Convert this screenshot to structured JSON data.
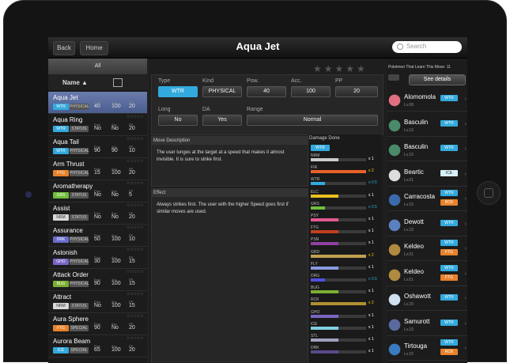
{
  "window": {
    "back": "Back",
    "home": "Home",
    "title": "Aqua Jet",
    "search_placeholder": "Search"
  },
  "colors": {
    "water": "#33aadd",
    "fighting": "#e8822a",
    "grass": "#6fbf3a",
    "normal": "#d8d8d8",
    "status": "#555555",
    "dark": "#6a6acc",
    "ghost": "#7a65c4",
    "bug": "#7ab030",
    "psychic": "#cc4488",
    "ice": "#d8f0f8",
    "physical": "#555555",
    "special": "#555555"
  },
  "list": {
    "all_label": "All",
    "sort_label": "Name ▲",
    "col_pow": "Pow.",
    "col_acc": "Acc.",
    "col_pp": "PP",
    "items": [
      {
        "name": "Aqua Jet",
        "type": "WTR",
        "tc": "#33aadd",
        "kind": "PHYSICAL",
        "pow": "40",
        "acc": "100",
        "pp": "20",
        "sel": true
      },
      {
        "name": "Aqua Ring",
        "type": "WTR",
        "tc": "#33aadd",
        "kind": "STATUS",
        "pow": "No",
        "acc": "No",
        "pp": "20"
      },
      {
        "name": "Aqua Tail",
        "type": "WTR",
        "tc": "#33aadd",
        "kind": "PHYSICAL",
        "pow": "90",
        "acc": "90",
        "pp": "10"
      },
      {
        "name": "Arm Thrust",
        "type": "FTG",
        "tc": "#e8822a",
        "kind": "PHYSICAL",
        "pow": "15",
        "acc": "100",
        "pp": "20"
      },
      {
        "name": "Aromatherapy",
        "type": "GRS",
        "tc": "#6fbf3a",
        "kind": "STATUS",
        "pow": "No",
        "acc": "No",
        "pp": "5"
      },
      {
        "name": "Assist",
        "type": "NRM",
        "tc": "#d8d8d8",
        "kind": "STATUS",
        "pow": "No",
        "acc": "No",
        "pp": "20"
      },
      {
        "name": "Assurance",
        "type": "DRK",
        "tc": "#6a6acc",
        "kind": "PHYSICAL",
        "pow": "50",
        "acc": "100",
        "pp": "10"
      },
      {
        "name": "Astonish",
        "type": "GHO",
        "tc": "#7a65c4",
        "kind": "PHYSICAL",
        "pow": "30",
        "acc": "100",
        "pp": "15"
      },
      {
        "name": "Attack Order",
        "type": "BUG",
        "tc": "#7ab030",
        "kind": "PHYSICAL",
        "pow": "90",
        "acc": "100",
        "pp": "15"
      },
      {
        "name": "Attract",
        "type": "NRM",
        "tc": "#d8d8d8",
        "kind": "STATUS",
        "pow": "No",
        "acc": "100",
        "pp": "15"
      },
      {
        "name": "Aura Sphere",
        "type": "FTG",
        "tc": "#e8822a",
        "kind": "SPECIAL",
        "pow": "90",
        "acc": "No",
        "pp": "20"
      },
      {
        "name": "Aurora Beam",
        "type": "ICE",
        "tc": "#33aadd",
        "kind": "SPECIAL",
        "pow": "65",
        "acc": "100",
        "pp": "20"
      }
    ]
  },
  "detail": {
    "type_label": "Type",
    "type": "WTR",
    "kind_label": "Kind",
    "kind": "PHYSICAL",
    "pow_label": "Pow.",
    "pow": "40",
    "acc_label": "Acc.",
    "acc": "100",
    "pp_label": "PP",
    "pp": "20",
    "long_label": "Long",
    "long": "No",
    "da_label": "DA",
    "da": "Yes",
    "range_label": "Range",
    "range": "Normal",
    "desc_head": "Move Description",
    "desc": "The user lunges at the target at a speed that makes it almost invisible. It is sure to strike first.",
    "effect_head": "Effect",
    "effect": "Always strikes first. The user with the higher Speed goes first if similar moves are used."
  },
  "damage": {
    "head": "Damage Done",
    "type": "WTR",
    "rows": [
      {
        "t": "NRM",
        "c": "#cccccc",
        "v": 0.5,
        "m": "x 1",
        "mc": "#ffffff"
      },
      {
        "t": "FIR",
        "c": "#e8622a",
        "v": 1.0,
        "m": "x 2",
        "mc": "#ffcc00"
      },
      {
        "t": "WTR",
        "c": "#33aadd",
        "v": 0.25,
        "m": "x 0.5",
        "mc": "#33aadd"
      },
      {
        "t": "ELC",
        "c": "#e8c020",
        "v": 0.5,
        "m": "x 1",
        "mc": "#ffffff"
      },
      {
        "t": "GRS",
        "c": "#6fbf3a",
        "v": 0.25,
        "m": "x 0.5",
        "mc": "#33aadd"
      },
      {
        "t": "PSY",
        "c": "#e05a90",
        "v": 0.5,
        "m": "x 1",
        "mc": "#ffffff"
      },
      {
        "t": "FTG",
        "c": "#c04020",
        "v": 0.5,
        "m": "x 1",
        "mc": "#ffffff"
      },
      {
        "t": "PSN",
        "c": "#9040a0",
        "v": 0.5,
        "m": "x 1",
        "mc": "#ffffff"
      },
      {
        "t": "GRD",
        "c": "#c0a050",
        "v": 1.0,
        "m": "x 2",
        "mc": "#ffcc00"
      },
      {
        "t": "FLY",
        "c": "#8a9ae0",
        "v": 0.5,
        "m": "x 1",
        "mc": "#ffffff"
      },
      {
        "t": "DRG",
        "c": "#5050e0",
        "v": 0.25,
        "m": "x 0.5",
        "mc": "#33aadd"
      },
      {
        "t": "BUG",
        "c": "#7ab030",
        "v": 0.5,
        "m": "x 1",
        "mc": "#ffffff"
      },
      {
        "t": "RCK",
        "c": "#b09030",
        "v": 1.0,
        "m": "x 2",
        "mc": "#ffcc00"
      },
      {
        "t": "GHO",
        "c": "#7a65c4",
        "v": 0.5,
        "m": "x 1",
        "mc": "#ffffff"
      },
      {
        "t": "ICE",
        "c": "#80d0e0",
        "v": 0.5,
        "m": "x 1",
        "mc": "#ffffff"
      },
      {
        "t": "STL",
        "c": "#a0a0c0",
        "v": 0.5,
        "m": "x 1",
        "mc": "#ffffff"
      },
      {
        "t": "DRK",
        "c": "#5a4a8a",
        "v": 0.5,
        "m": "x 1",
        "mc": "#ffffff"
      }
    ]
  },
  "learners": {
    "head": "Pokémon That Learn This Move: 11",
    "see_details": "See details",
    "items": [
      {
        "name": "Alomomola",
        "lv": "Lv.08",
        "t1": "WTR",
        "c1": "#33aadd",
        "sc": "#e07080"
      },
      {
        "name": "Basculin",
        "lv": "Lv.10",
        "t1": "WTR",
        "c1": "#33aadd",
        "sc": "#4a8a6a"
      },
      {
        "name": "Basculin",
        "lv": "Lv.10",
        "t1": "WTR",
        "c1": "#33aadd",
        "sc": "#4a8a6a"
      },
      {
        "name": "Beartic",
        "lv": "Lv.01",
        "t1": "ICE",
        "c1": "#d8f0f8",
        "sc": "#dddddd"
      },
      {
        "name": "Carracosta",
        "lv": "Lv.15",
        "t1": "WTR",
        "c1": "#33aadd",
        "t2": "RCK",
        "c2": "#e8822a",
        "sc": "#3a6aaa"
      },
      {
        "name": "Dewott",
        "lv": "Lv.33",
        "t1": "WTR",
        "c1": "#33aadd",
        "sc": "#5a80c0"
      },
      {
        "name": "Keldeo",
        "lv": "Lv.01",
        "t1": "WTR",
        "c1": "#33aadd",
        "t2": "FTG",
        "c2": "#e8822a",
        "sc": "#b08a40"
      },
      {
        "name": "Keldeo",
        "lv": "Lv.01",
        "t1": "WTR",
        "c1": "#33aadd",
        "t2": "FTG",
        "c2": "#e8822a",
        "sc": "#b08a40"
      },
      {
        "name": "Oshawott",
        "lv": "Lv.29",
        "t1": "WTR",
        "c1": "#33aadd",
        "sc": "#d0e0f0"
      },
      {
        "name": "Samurott",
        "lv": "Lv.33",
        "t1": "WTR",
        "c1": "#33aadd",
        "sc": "#5a6aa0"
      },
      {
        "name": "Tirtouga",
        "lv": "Lv.15",
        "t1": "WTR",
        "c1": "#33aadd",
        "t2": "RCK",
        "c2": "#e8822a",
        "sc": "#3a7ac0"
      }
    ]
  }
}
